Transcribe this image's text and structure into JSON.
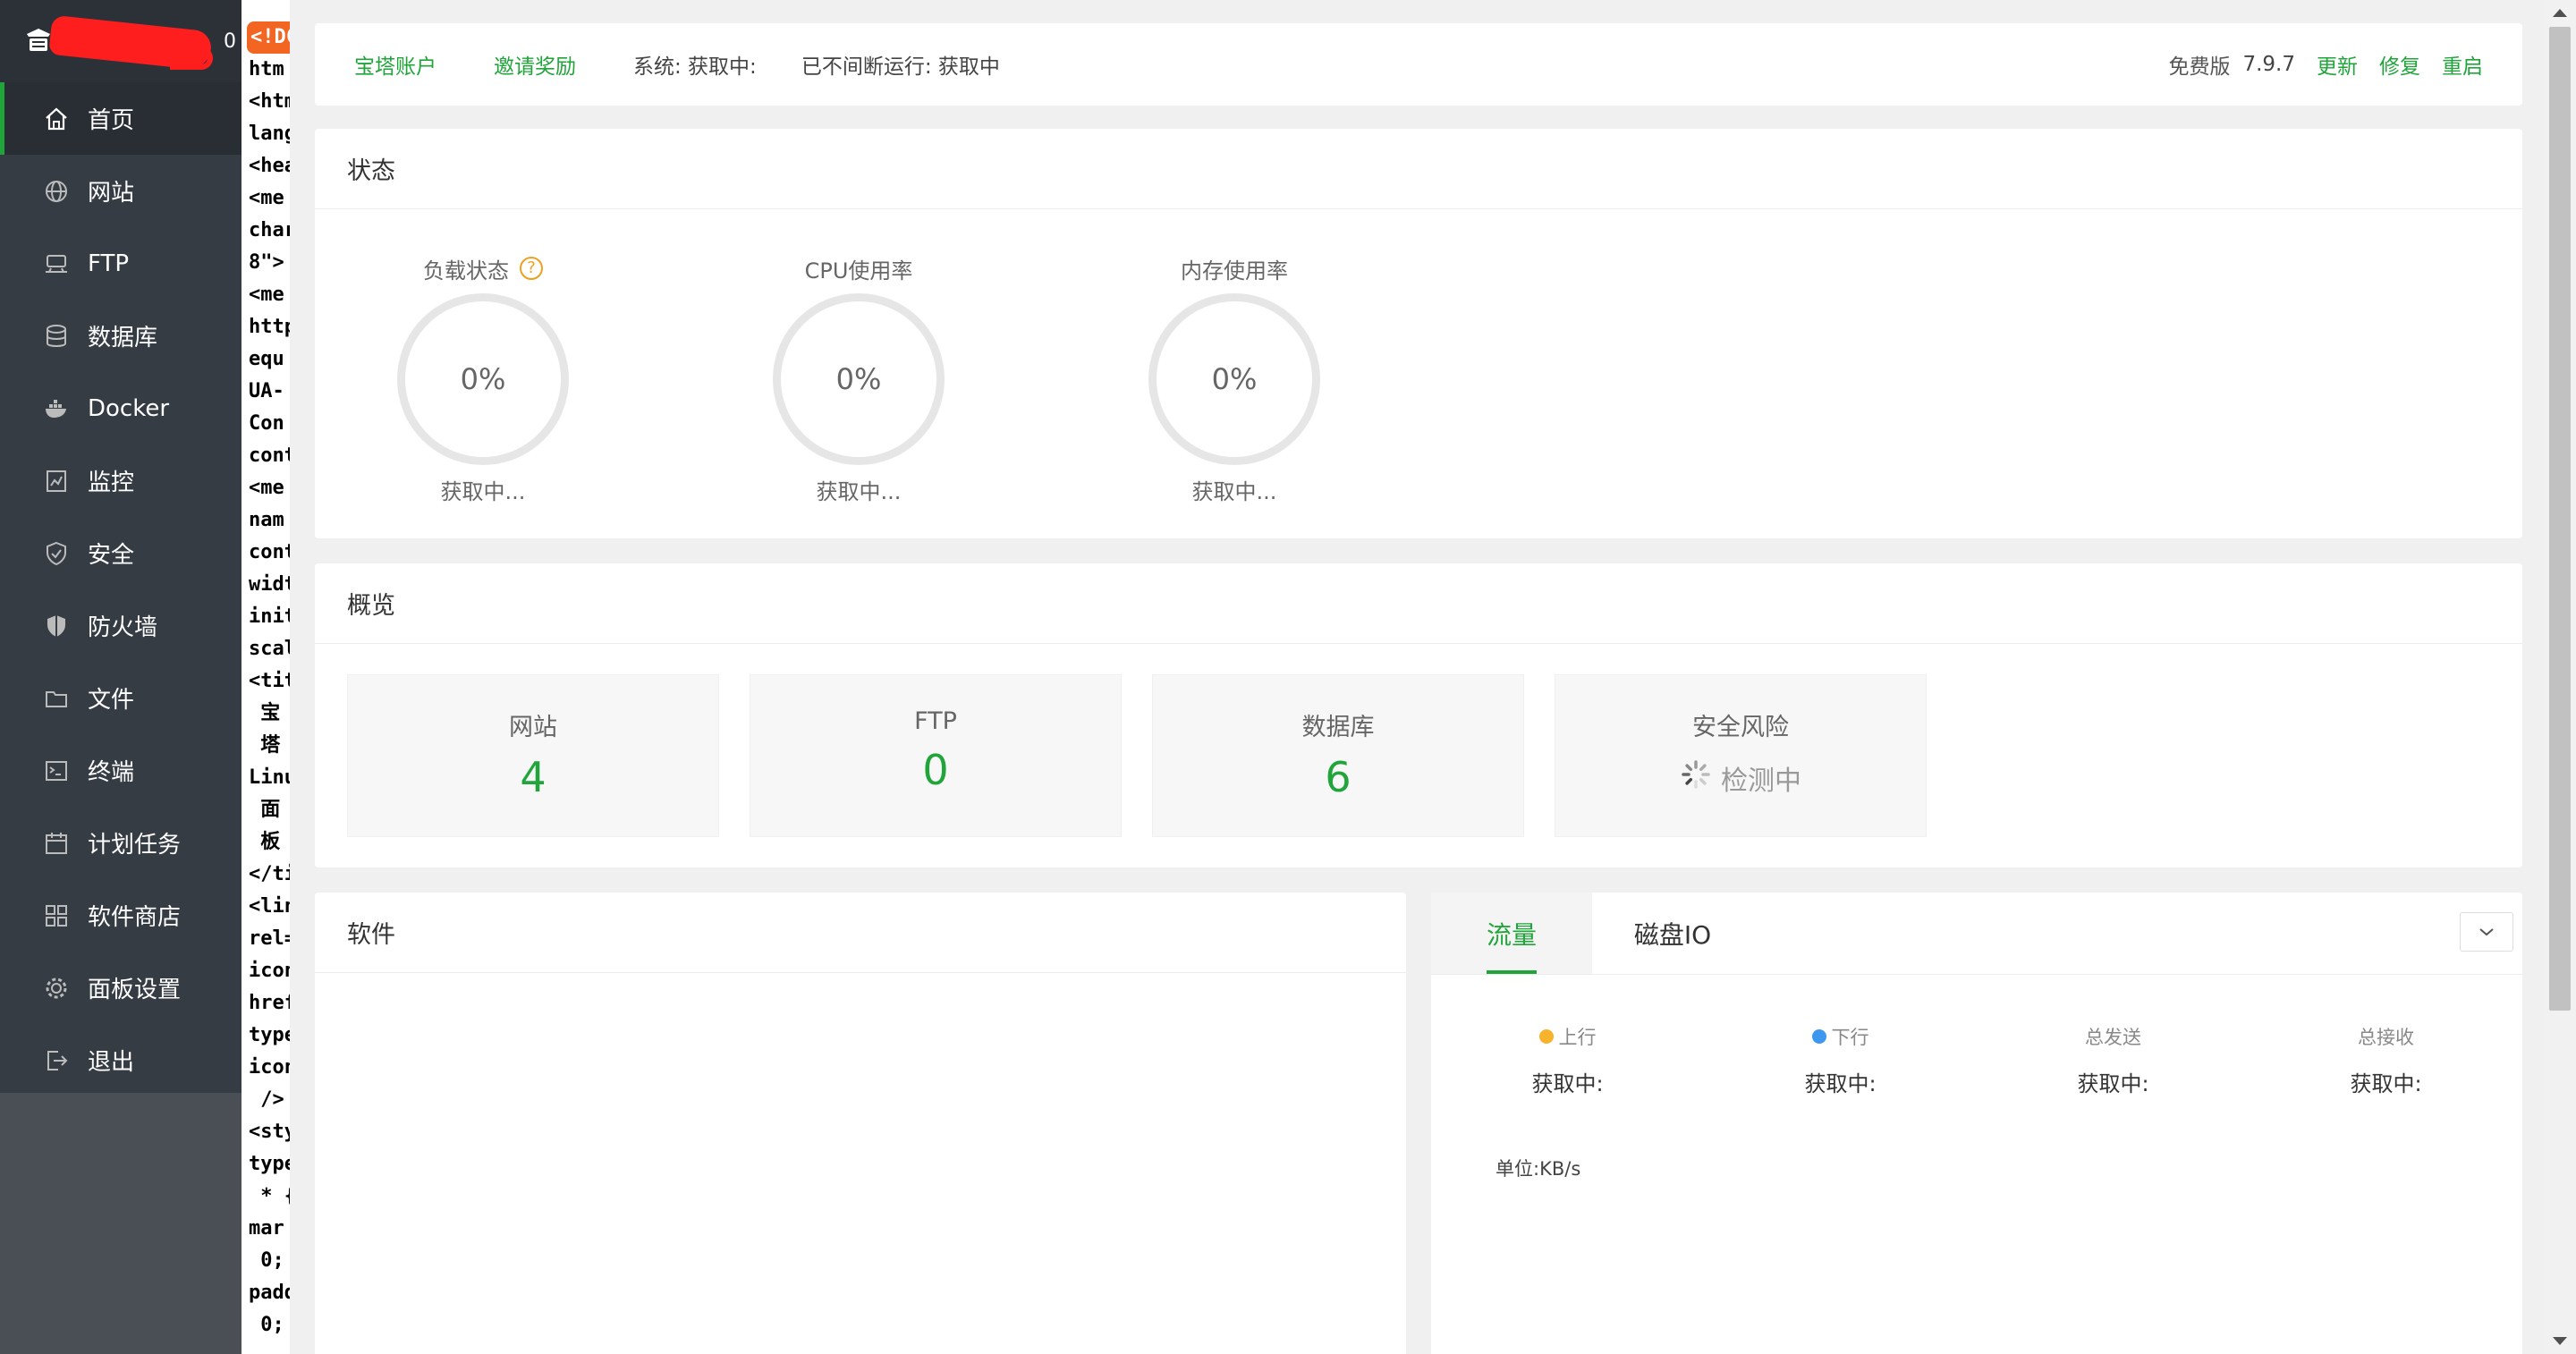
{
  "sidebar": {
    "server_name": "0",
    "items": [
      {
        "label": "首页",
        "icon": "home-icon"
      },
      {
        "label": "网站",
        "icon": "globe-icon"
      },
      {
        "label": "FTP",
        "icon": "ftp-icon"
      },
      {
        "label": "数据库",
        "icon": "database-icon"
      },
      {
        "label": "Docker",
        "icon": "docker-icon"
      },
      {
        "label": "监控",
        "icon": "monitor-icon"
      },
      {
        "label": "安全",
        "icon": "shield-check-icon"
      },
      {
        "label": "防火墙",
        "icon": "firewall-icon"
      },
      {
        "label": "文件",
        "icon": "folder-icon"
      },
      {
        "label": "终端",
        "icon": "terminal-icon"
      },
      {
        "label": "计划任务",
        "icon": "calendar-icon"
      },
      {
        "label": "软件商店",
        "icon": "grid-icon"
      },
      {
        "label": "面板设置",
        "icon": "gear-icon"
      },
      {
        "label": "退出",
        "icon": "logout-icon"
      }
    ]
  },
  "code_strip": {
    "badge": "<!DC",
    "lines": [
      "htm",
      "<htm",
      "lang",
      "<hea",
      "<me",
      "char",
      "8\">",
      "<me",
      "http",
      "equ",
      "UA-",
      "Con",
      "cont",
      "<me",
      "nam",
      "cont",
      "widt",
      "initi",
      "scal",
      "<titl",
      " 宝",
      " 塔",
      "Linu",
      " 面",
      " 板",
      "</tit",
      "<lin",
      "rel=",
      "icon",
      "href",
      "type",
      "icon",
      " />",
      "<sty",
      "type",
      " * {",
      "mar",
      " 0;",
      "padd",
      " 0;"
    ]
  },
  "topbar": {
    "account": "宝塔账户",
    "invite": "邀请奖励",
    "system": "系统:   获取中:",
    "uptime": "已不间断运行: 获取中",
    "edition": "免费版",
    "version": "7.9.7",
    "update": "更新",
    "repair": "修复",
    "restart": "重启"
  },
  "status": {
    "title": "状态",
    "gauges": [
      {
        "title": "负载状态",
        "value": "0%",
        "sub": "获取中...",
        "percent": 0
      },
      {
        "title": "CPU使用率",
        "value": "0%",
        "sub": "获取中...",
        "percent": 0
      },
      {
        "title": "内存使用率",
        "value": "0%",
        "sub": "获取中...",
        "percent": 0
      }
    ]
  },
  "overview": {
    "title": "概览",
    "boxes": [
      {
        "label": "网站",
        "value": "4"
      },
      {
        "label": "FTP",
        "value": "0"
      },
      {
        "label": "数据库",
        "value": "6"
      },
      {
        "label": "安全风险",
        "value": "检测中"
      }
    ]
  },
  "software": {
    "title": "软件"
  },
  "traffic": {
    "tabs": [
      "流量",
      "磁盘IO"
    ],
    "stats": [
      {
        "label": "上行",
        "value": "获取中:",
        "dot_color": "#f7b32b"
      },
      {
        "label": "下行",
        "value": "获取中:",
        "dot_color": "#3d97ef"
      },
      {
        "label": "总发送",
        "value": "获取中:"
      },
      {
        "label": "总接收",
        "value": "获取中:"
      }
    ],
    "unit": "单位:KB/s"
  },
  "colors": {
    "accent": "#20a53a",
    "sidebar": "#353c44"
  }
}
